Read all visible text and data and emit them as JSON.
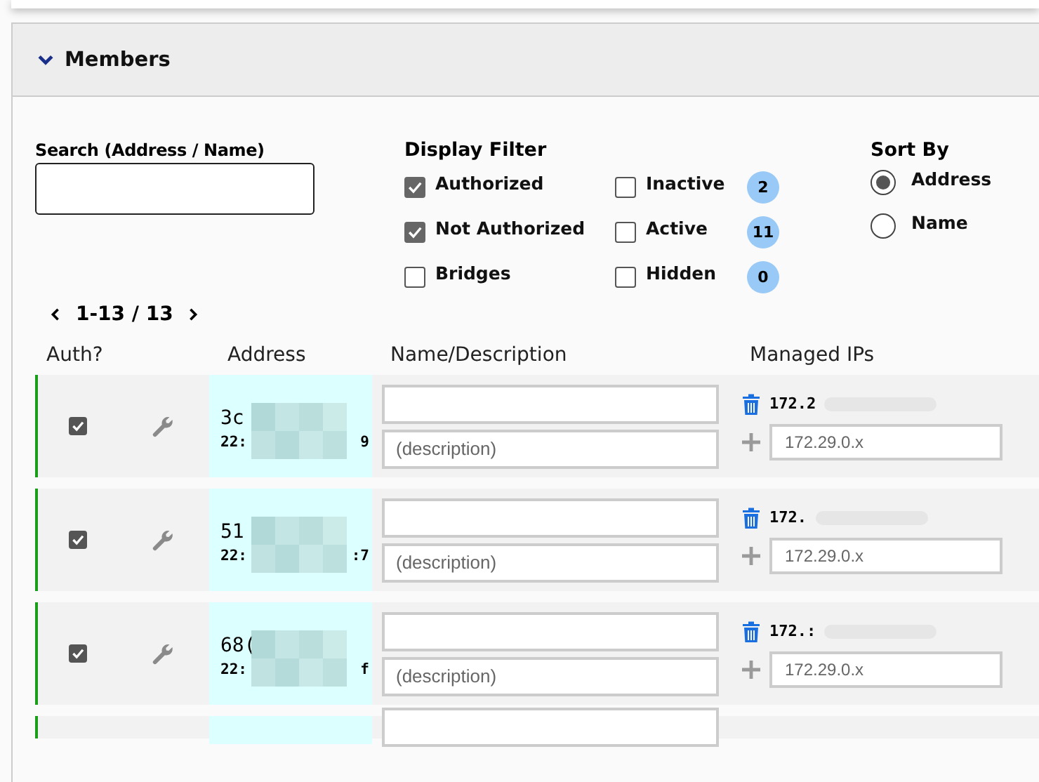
{
  "panel": {
    "title": "Members",
    "expanded": true
  },
  "search": {
    "label": "Search (Address / Name)"
  },
  "display_filter": {
    "title": "Display Filter",
    "options": [
      {
        "label": "Authorized",
        "checked": true
      },
      {
        "label": "Inactive",
        "checked": false,
        "count": "2"
      },
      {
        "label": "Not Authorized",
        "checked": true
      },
      {
        "label": "Active",
        "checked": false,
        "count": "11"
      },
      {
        "label": "Bridges",
        "checked": false
      },
      {
        "label": "Hidden",
        "checked": false,
        "count": "0"
      }
    ]
  },
  "sort_by": {
    "title": "Sort By",
    "options": [
      {
        "label": "Address",
        "selected": true
      },
      {
        "label": "Name",
        "selected": false
      }
    ]
  },
  "pager": {
    "range": "1-13 / 13"
  },
  "table": {
    "columns": [
      "Auth?",
      "Address",
      "Name/Description",
      "Managed IPs"
    ],
    "rows": [
      {
        "authorized": true,
        "address_start": "3c",
        "address_line2_start": "22:",
        "address_line2_end": "9",
        "name": "",
        "description_placeholder": "(description)",
        "ip": "172.2",
        "new_ip_placeholder": "172.29.0.x"
      },
      {
        "authorized": true,
        "address_start": "51",
        "address_line2_start": "22:",
        "address_line2_end": ":7",
        "name": "",
        "description_placeholder": "(description)",
        "ip": "172.",
        "new_ip_placeholder": "172.29.0.x"
      },
      {
        "authorized": true,
        "address_start": "68(",
        "address_line2_start": "22:",
        "address_line2_end": "f",
        "name": "",
        "description_placeholder": "(description)",
        "ip": "172.:",
        "new_ip_placeholder": "172.29.0.x"
      },
      {
        "partial": true
      }
    ]
  }
}
